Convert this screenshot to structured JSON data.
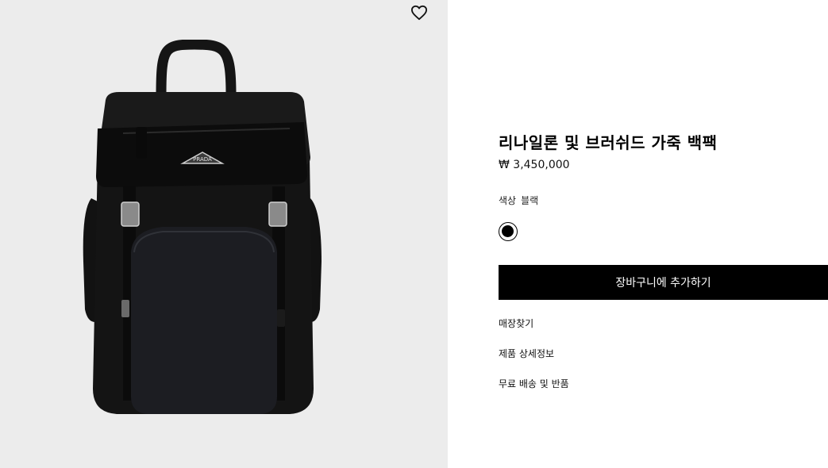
{
  "product": {
    "title": "리나일론 및 브러쉬드 가죽 백팩",
    "price": "₩ 3,450,000",
    "color_label": "색상",
    "color_value": "블랙"
  },
  "logo_text": "PRADA",
  "swatch": {
    "color": "#000000"
  },
  "actions": {
    "add_to_cart": "장바구니에 추가하기",
    "find_store": "매장찾기",
    "product_details": "제품 상세정보",
    "free_shipping_returns": "무료 배송 및 반품"
  },
  "icons": {
    "wishlist": "heart-outline-icon"
  },
  "colors": {
    "image_background": "#ececec",
    "button": "#000000",
    "button_text": "#ffffff"
  }
}
